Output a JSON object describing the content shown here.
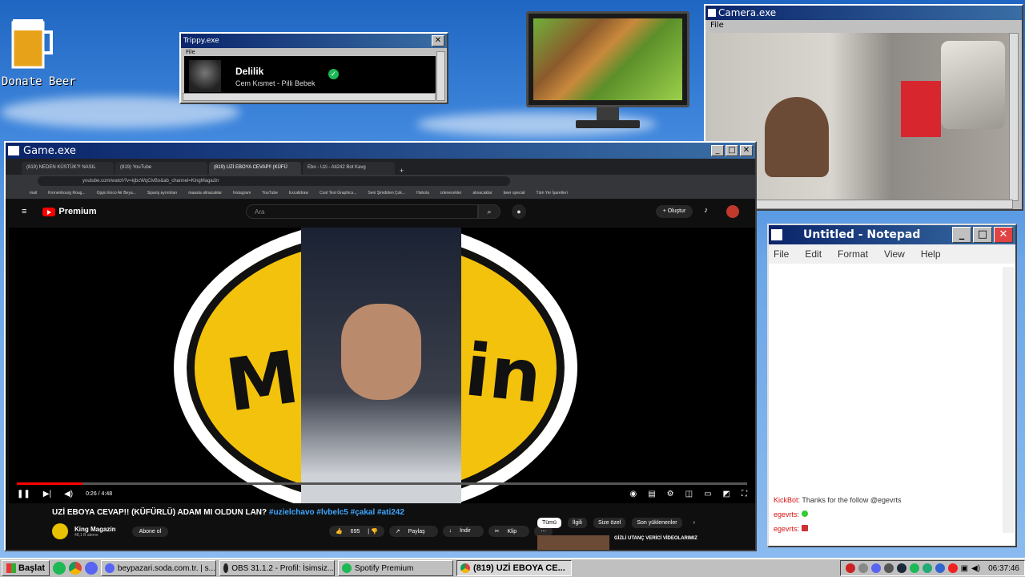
{
  "desktop": {
    "donate_label": "Donate Beer"
  },
  "trippy": {
    "title": "Trippy.exe",
    "menu": "File",
    "song_title": "Delilik",
    "song_artist": "Cem Kısmet - Pilli Bebek",
    "close": "✕"
  },
  "camera": {
    "title": "Camera.exe",
    "menu": "File"
  },
  "game": {
    "title": "Game.exe",
    "tabs": [
      "(819) NEDEN KÜSTÜK?! NASIL",
      "(819) YouTube",
      "(819) UZİ EBOYA CEVAP!! (KÜFÜ",
      "Ebo - Uzi - Ati242 Bot Kavg"
    ],
    "url": "youtube.com/watch?v=kjbcWqClvBo&ab_channel=KingMagazin",
    "bookmarks": [
      "mail",
      "Kronenbourg Roug...",
      "Oppo Enco Air Beya...",
      "Sipariş ayrıntıları",
      "maasta alinacaklar",
      "Instagram",
      "YouTube",
      "Excalidraw",
      "Cool Text Graphics...",
      "Seni Şimdiden Çok...",
      "Hahola",
      "izlenecekler",
      "alınacaklar",
      "beer special",
      "Tüm Yer İşaretleri"
    ],
    "yt_brand": "Premium",
    "search_placeholder": "Ara",
    "create_label": "+ Oluştur",
    "time": "0:26 / 4:48",
    "progress": 0.09,
    "video_title": "UZİ EBOYA CEVAP!! (KÜFÜRLÜ) ADAM MI OLDUN LAN?",
    "video_tags": "#uzielchavo #lvbelc5 #çakal #ati242",
    "channel_name": "King Magazin",
    "channel_subs": "48,1 B abone",
    "subscribe": "Abone ol",
    "likes": "695",
    "share": "Paylaş",
    "download": "İndir",
    "clip": "Klip",
    "chips": [
      "Tümü",
      "İlgili",
      "Size özel",
      "Son yüklenenler"
    ],
    "rec_title": "GİZLİ UTANÇ VERİCİ VİDEOLARIMIZ"
  },
  "notepad": {
    "title": "Untitled - Notepad",
    "menu": [
      "File",
      "Edit",
      "Format",
      "View",
      "Help"
    ],
    "chat": [
      {
        "user": "KickBot",
        "msg": ": Thanks for the follow @egevrts"
      },
      {
        "user": "egevrts",
        "msg": ":"
      },
      {
        "user": "egevrts",
        "msg": ":"
      }
    ]
  },
  "taskbar": {
    "start": "Başlat",
    "tasks": [
      "beypazari.soda.com.tr. | s...",
      "OBS 31.1.2 - Profil: İsimsiz...",
      "Spotify Premium",
      "(819) UZİ EBOYA CE..."
    ],
    "clock": "06:37:46"
  }
}
